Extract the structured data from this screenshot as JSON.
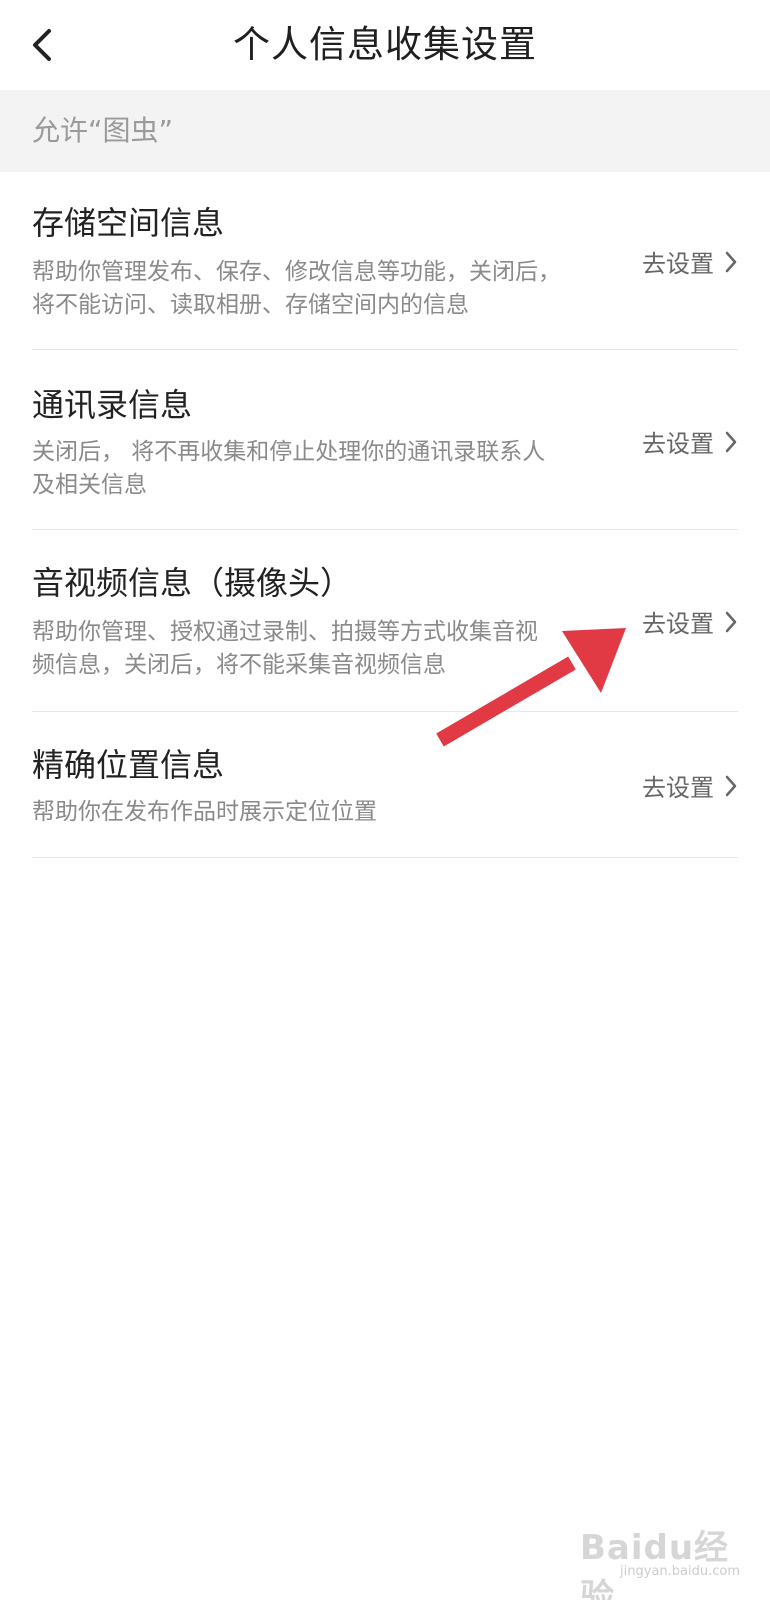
{
  "navbar": {
    "title": "个人信息收集设置"
  },
  "section": {
    "label": "允许“图虫”"
  },
  "items": [
    {
      "title": "存储空间信息",
      "desc_line1": "帮助你管理发布、保存、修改信息等功能，关闭后，",
      "desc_line2": "将不能访问、读取相册、存储空间内的信息",
      "action": "去设置"
    },
    {
      "title": "通讯录信息",
      "desc_line1": "关闭后， 将不再收集和停止处理你的通讯录联系人",
      "desc_line2": "及相关信息",
      "action": "去设置"
    },
    {
      "title": "音视频信息（摄像头）",
      "desc_line1": "帮助你管理、授权通过录制、拍摄等方式收集音视",
      "desc_line2": "频信息，关闭后，将不能采集音视频信息",
      "action": "去设置"
    },
    {
      "title": "精确位置信息",
      "desc_line1": "帮助你在发布作品时展示定位位置",
      "action": "去设置"
    }
  ],
  "watermark": {
    "main": "Baidu经验",
    "sub": "jingyan.baidu.com"
  },
  "colors": {
    "arrow": "#e23a44",
    "section_bg": "#f3f3f3",
    "divider": "#e8e8e8"
  },
  "icons": {
    "back": "chevron-left-icon",
    "item_chevron": "chevron-right-icon"
  }
}
